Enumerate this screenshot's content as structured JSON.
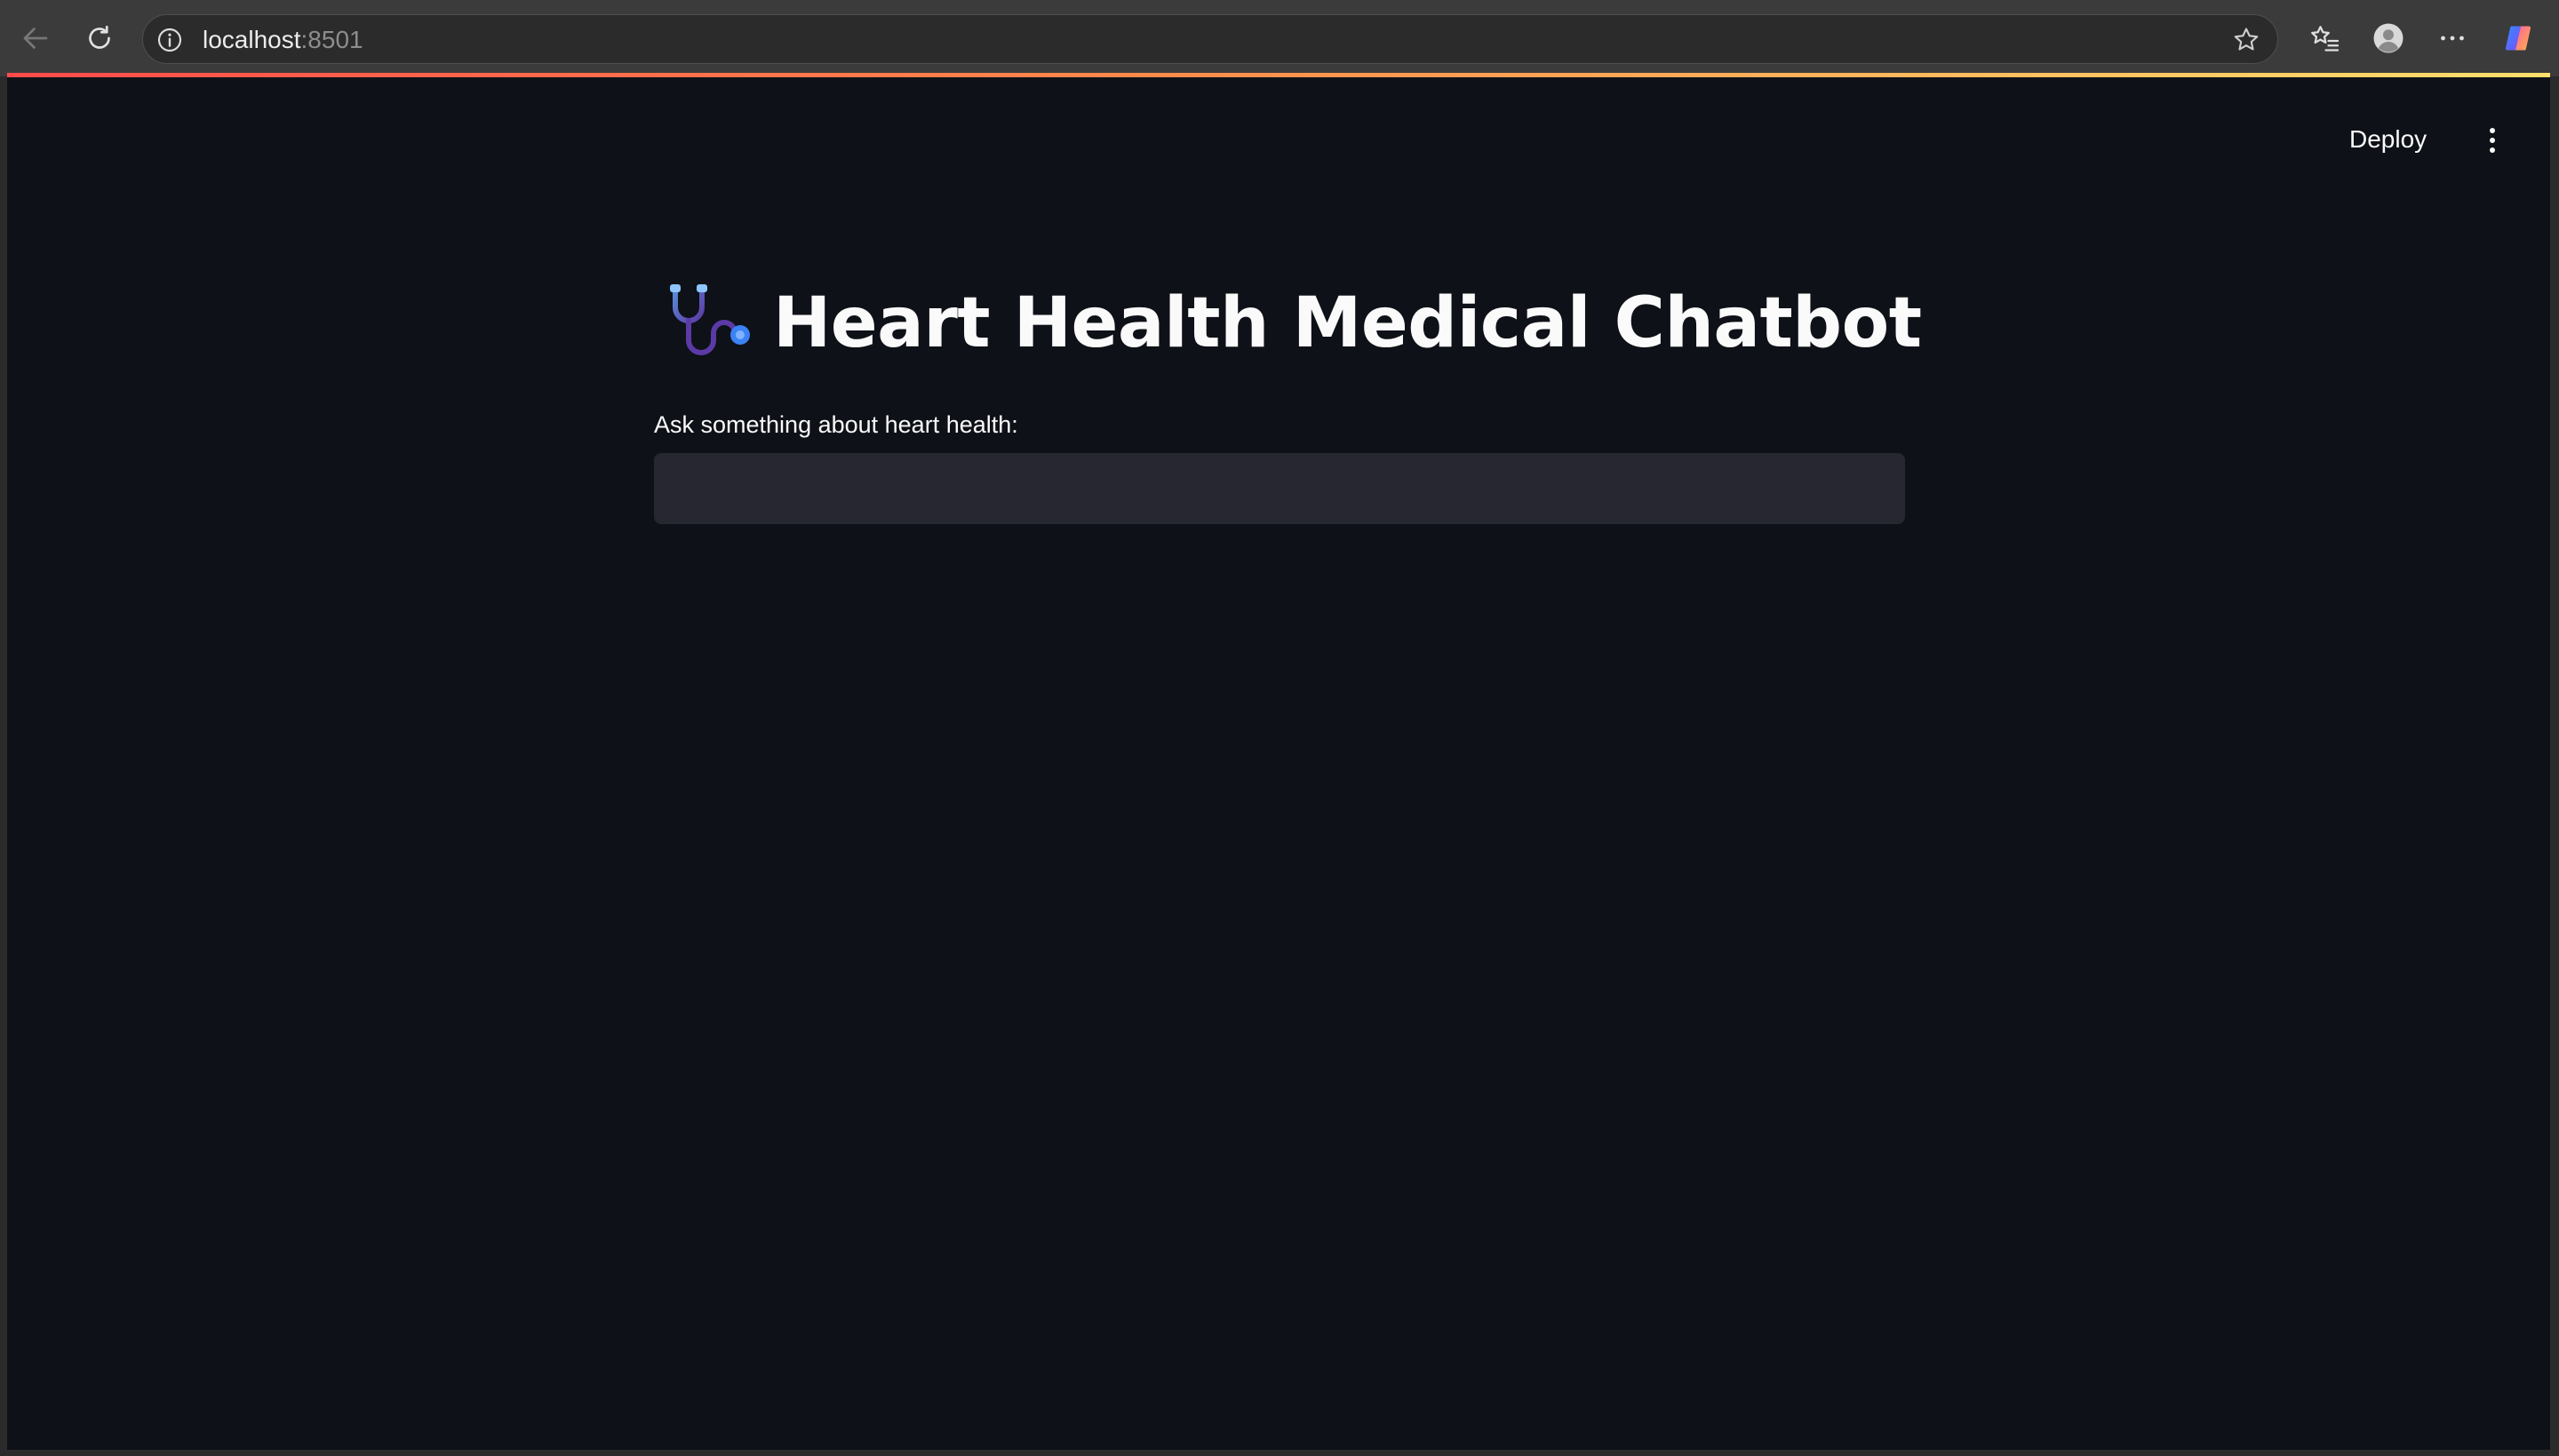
{
  "browser": {
    "url_host": "localhost",
    "url_rest": ":8501"
  },
  "app": {
    "toolbar": {
      "deploy_label": "Deploy"
    },
    "title": "Heart Health Medical Chatbot",
    "title_icon": "stethoscope-icon",
    "question": {
      "label": "Ask something about heart health:",
      "value": "",
      "placeholder": ""
    }
  },
  "colors": {
    "app_background": "#0e1117",
    "input_background": "#262730",
    "text": "#fafafa",
    "browser_chrome": "#3b3b3b",
    "decoration_gradient": [
      "#ff4b4b",
      "#ffdf6b"
    ]
  }
}
